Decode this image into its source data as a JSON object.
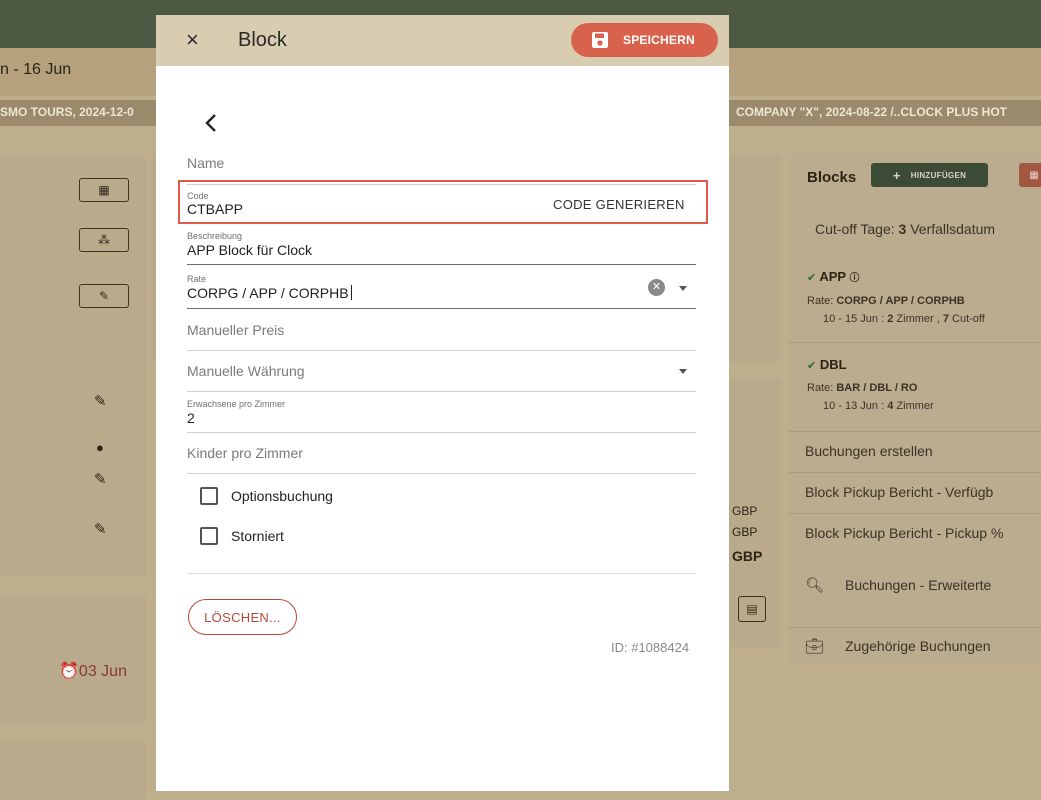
{
  "background": {
    "date_range": "n - 16 Jun",
    "crumb_left": "SMO TOURS, 2024-12-0",
    "crumb_right": "COMPANY \"X\", 2024-08-22  /..CLOCK PLUS HOT",
    "alarm_text": "03 Jun",
    "gbp_1": "GBP",
    "gbp_2": "GBP",
    "gbp_3": "GBP",
    "right_panel": {
      "title": "Blocks",
      "add_label": "HINZUFÜGEN",
      "cutoff_prefix": "Cut-off Tage: ",
      "cutoff_days": "3",
      "cutoff_suffix": " Verfallsdatum",
      "blocks": [
        {
          "name": "APP",
          "rate_prefix": "Rate: ",
          "rate": "CORPG / APP / CORPHB",
          "detail_prefix": "10 - 15 Jun : ",
          "rooms": "2",
          "rooms_label": " Zimmer , ",
          "cutoff": "7",
          "cutoff_label": " Cut-off"
        },
        {
          "name": "DBL",
          "rate_prefix": "Rate: ",
          "rate": "BAR / DBL / RO",
          "detail_prefix": "10 - 13 Jun : ",
          "rooms": "4",
          "rooms_label": " Zimmer"
        }
      ],
      "rows": [
        "Buchungen erstellen",
        "Block Pickup Bericht - Verfügb",
        "Block Pickup Bericht - Pickup %",
        "Buchungen - Erweiterte",
        "Zugehörige Buchungen"
      ]
    }
  },
  "modal": {
    "title": "Block",
    "save_label": "SPEICHERN",
    "close_icon": "×",
    "back_icon": "‹",
    "name_placeholder": "Name",
    "code": {
      "label": "Code",
      "value": "CTBAPP",
      "generate_label": "CODE GENERIEREN"
    },
    "description": {
      "label": "Beschreibung",
      "value": "APP Block für Clock"
    },
    "rate": {
      "label": "Rate",
      "value": "CORPG / APP / CORPHB"
    },
    "manual_price_placeholder": "Manueller Preis",
    "manual_currency_placeholder": "Manuelle Währung",
    "adults": {
      "label": "Erwachsene pro Zimmer",
      "value": "2"
    },
    "children_placeholder": "Kinder pro Zimmer",
    "option_booking_label": "Optionsbuchung",
    "option_booking_checked": false,
    "cancelled_label": "Storniert",
    "cancelled_checked": false,
    "delete_label": "LÖSCHEN...",
    "id_text": "ID: #1088424"
  },
  "colors": {
    "accent": "#d9624c",
    "highlight_border": "#e0584e",
    "header": "#d9cdb1",
    "topbar": "#4c5a44"
  }
}
